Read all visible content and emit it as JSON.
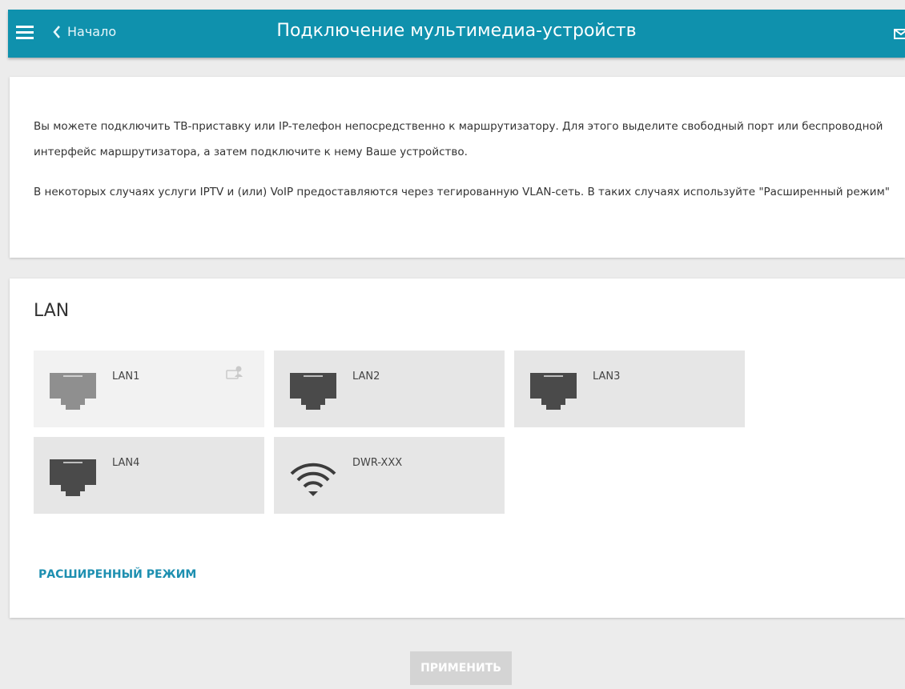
{
  "header": {
    "back_label": "Начало",
    "title": "Подключение мультимедиа-устройств",
    "menu_icon": "hamburger-menu-icon",
    "back_icon": "chevron-left-icon",
    "mail_icon": "envelope-icon",
    "accent_color": "#0f91ad"
  },
  "info": {
    "paragraph1": "Вы можете подключить ТВ-приставку или IP-телефон непосредственно к маршрутизатору. Для этого выделите свободный порт или беспроводной интерфейс маршрутизатора, а затем подключите к нему Ваше устройство.",
    "paragraph2": "В некоторых случаях услуги IPTV и (или) VoIP предоставляются через тегированную VLAN-сеть. В таких случаях используйте \"Расширенный режим\""
  },
  "lan": {
    "title": "LAN",
    "ports": [
      {
        "label": "LAN1",
        "icon": "ethernet-port-icon",
        "state": "disabled",
        "side_icon": "pc-user-icon"
      },
      {
        "label": "LAN2",
        "icon": "ethernet-port-icon",
        "state": "available"
      },
      {
        "label": "LAN3",
        "icon": "ethernet-port-icon",
        "state": "available"
      },
      {
        "label": "LAN4",
        "icon": "ethernet-port-icon",
        "state": "available"
      },
      {
        "label": "DWR-XXX",
        "icon": "wifi-icon",
        "state": "available"
      }
    ],
    "advanced_link": "РАСШИРЕННЫЙ РЕЖИМ"
  },
  "footer": {
    "apply_label": "ПРИМЕНИТЬ"
  }
}
